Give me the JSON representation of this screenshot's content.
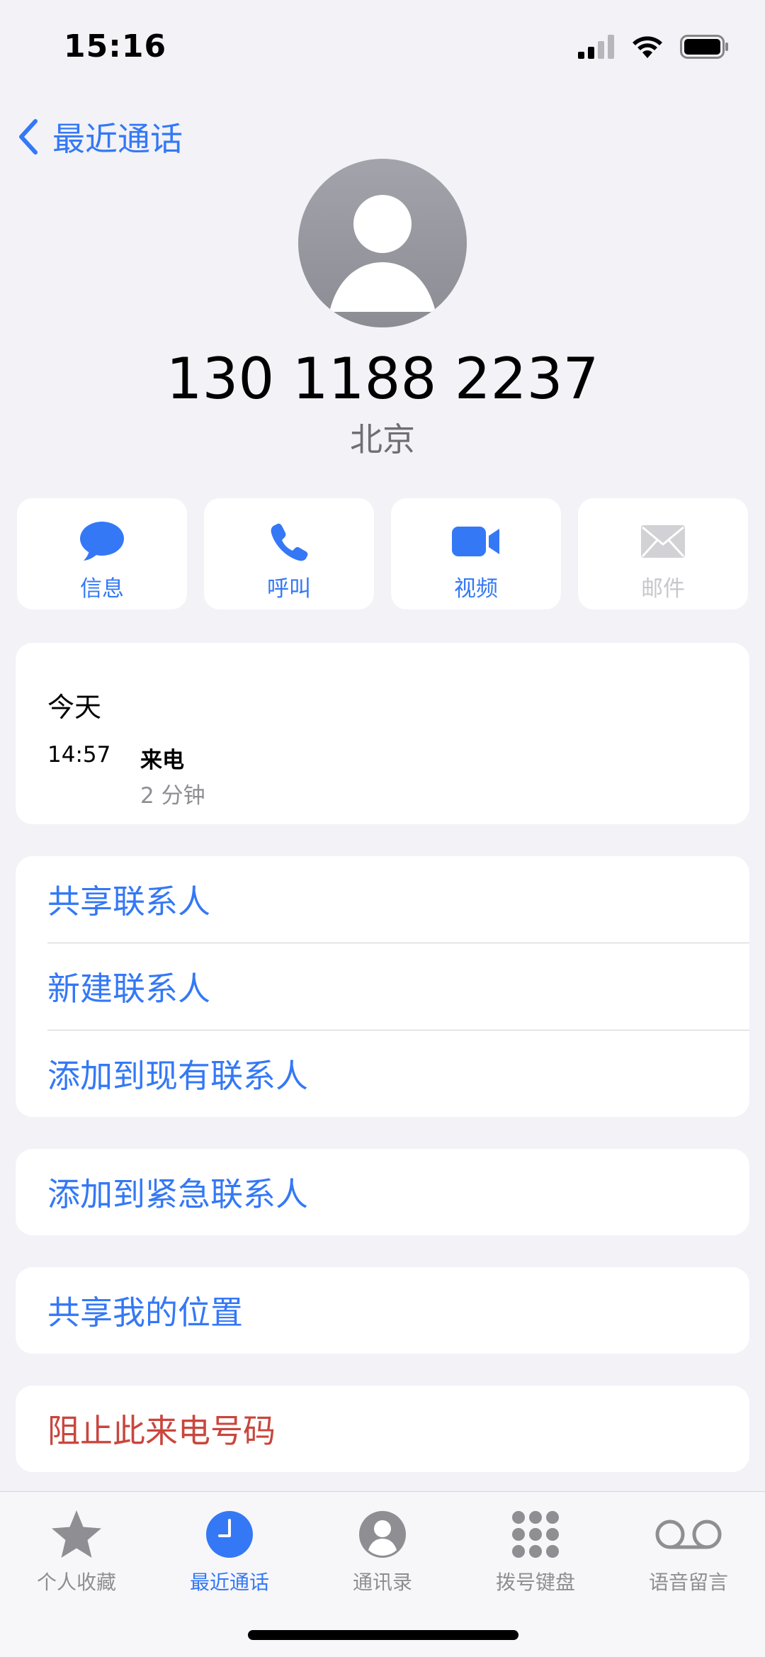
{
  "status": {
    "time": "15:16"
  },
  "nav": {
    "back_label": "最近通话"
  },
  "contact": {
    "number": "130 1188 2237",
    "location": "北京"
  },
  "actions": [
    {
      "label": "信息",
      "icon": "message-bubble-icon",
      "enabled": true
    },
    {
      "label": "呼叫",
      "icon": "phone-icon",
      "enabled": true
    },
    {
      "label": "视频",
      "icon": "video-camera-icon",
      "enabled": true
    },
    {
      "label": "邮件",
      "icon": "envelope-icon",
      "enabled": false
    }
  ],
  "history": {
    "date_label": "今天",
    "entries": [
      {
        "time": "14:57",
        "type": "来电",
        "duration": "2 分钟"
      }
    ]
  },
  "contact_actions": {
    "share_contact": "共享联系人",
    "new_contact": "新建联系人",
    "add_existing": "添加到现有联系人"
  },
  "emergency": {
    "add_emergency": "添加到紧急联系人"
  },
  "location": {
    "share_location": "共享我的位置"
  },
  "block": {
    "block_caller": "阻止此来电号码"
  },
  "tabs": [
    {
      "label": "个人收藏",
      "icon": "star-icon",
      "active": false
    },
    {
      "label": "最近通话",
      "icon": "clock-icon",
      "active": true
    },
    {
      "label": "通讯录",
      "icon": "person-circle-icon",
      "active": false
    },
    {
      "label": "拨号键盘",
      "icon": "keypad-icon",
      "active": false
    },
    {
      "label": "语音留言",
      "icon": "voicemail-icon",
      "active": false
    }
  ],
  "colors": {
    "accent": "#3478f6",
    "destructive": "#c9463d",
    "background": "#f2f2f7",
    "inactive_tab": "#8e8e93"
  }
}
